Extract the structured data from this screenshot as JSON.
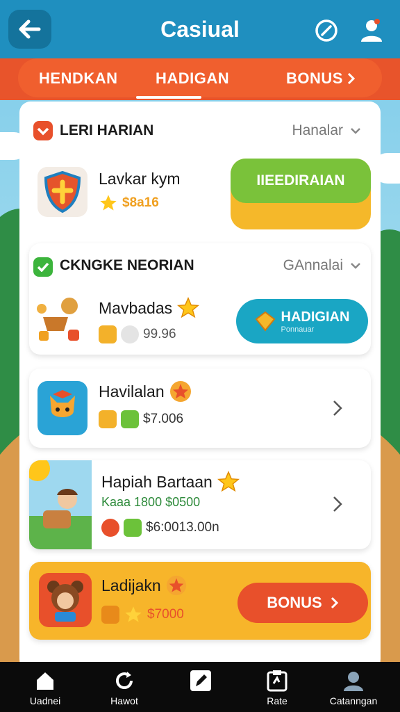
{
  "header": {
    "title": "Casiual"
  },
  "tabs": [
    {
      "label": "HENDKAN"
    },
    {
      "label": "HADIGAN"
    },
    {
      "label": "BONUS"
    }
  ],
  "sections": [
    {
      "title": "LERI HARIAN",
      "link": "Hanalar",
      "item": {
        "name": "Lavkar kym",
        "value": "$8a16",
        "button": "IIEEDIRAIAN"
      }
    },
    {
      "title": "CKNGKE NEORIAN",
      "link": "GAnnalai",
      "item": {
        "name": "Mavbadas",
        "value": "99.96",
        "button": "HADIGIAN",
        "button_sub": "Ponnauar"
      }
    }
  ],
  "items": [
    {
      "name": "Havilalan",
      "value": "$7.006"
    },
    {
      "name": "Hapiah Bartaan",
      "subtitle": "Kaaa 1800 $0500",
      "value": "$6:0013.00n"
    },
    {
      "name": "Ladijakn",
      "value": "$7000",
      "button": "BONUS"
    }
  ],
  "bottom_nav": [
    {
      "label": "Uadnei",
      "icon": "home-icon"
    },
    {
      "label": "Hawot",
      "icon": "refresh-icon"
    },
    {
      "label": "",
      "icon": "edit-icon"
    },
    {
      "label": "Rate",
      "icon": "clipboard-icon"
    },
    {
      "label": "Catanngan",
      "icon": "user-icon"
    }
  ],
  "colors": {
    "header": "#1f8fbf",
    "tabbar": "#e8542b",
    "green": "#7ac23a",
    "teal": "#1aa6c4",
    "orange": "#f5b82a",
    "red": "#e8502b"
  }
}
